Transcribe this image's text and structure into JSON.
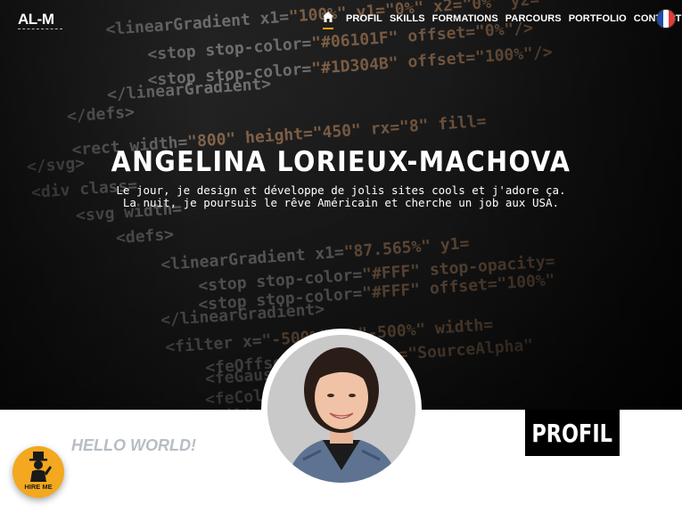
{
  "logo": {
    "text": "AL-M"
  },
  "nav": {
    "home_icon": "home-icon",
    "items": [
      {
        "label": "PROFIL"
      },
      {
        "label": "SKILLS"
      },
      {
        "label": "FORMATIONS"
      },
      {
        "label": "PARCOURS"
      },
      {
        "label": "PORTFOLIO"
      },
      {
        "label": "CONTACT"
      }
    ],
    "language_flag": "french-flag-icon",
    "accent_color": "#f0a500"
  },
  "hero": {
    "title": "ANGELINA LORIEUX-MACHOVA",
    "tagline_line1": "Le jour, je design et développe de jolis sites cools et j'adore ça.",
    "tagline_line2": "La nuit, je poursuis le rêve Américain et cherche un job aux USA.",
    "background_code": [
      {
        "code": "<linearGradient x1=",
        "str": "\"100%\" y1=\"0%\" x2=\"0%\" y2="
      },
      {
        "code": "<stop stop-color=",
        "str": "\"#06101F\" offset=\"0%\"/>"
      },
      {
        "code": "<stop stop-color=",
        "str": "\"#1D304B\" offset=\"100%\"/>"
      },
      {
        "code": "</linearGradient>",
        "str": ""
      },
      {
        "code": "</defs>",
        "str": ""
      },
      {
        "code": "<rect width=",
        "str": "\"800\" height=\"450\" rx=\"8\" fill="
      },
      {
        "code": "</svg>",
        "str": ""
      },
      {
        "code": "<div class=",
        "str": ""
      },
      {
        "code": "<svg width=",
        "str": ""
      },
      {
        "code": "<defs>",
        "str": ""
      },
      {
        "code": "<linearGradient x1=",
        "str": "\"87.565%\" y1="
      },
      {
        "code": "<stop stop-color=",
        "str": "\"#FFF\" stop-opacity="
      },
      {
        "code": "<stop stop-color=",
        "str": "\"#FFF\" offset=\"100%\""
      },
      {
        "code": "</linearGradient>",
        "str": ""
      },
      {
        "code": "<filter x=",
        "str": "\"-500%\" y=\"-500%\" width="
      },
      {
        "code": "<feOffset dy=",
        "str": "\"16\" in=\"SourceAlpha\""
      },
      {
        "code": "<feGaussi",
        "str": ""
      },
      {
        "code": "<feColo",
        "str": ""
      },
      {
        "code": "<filter",
        "str": ""
      }
    ]
  },
  "profile": {
    "hello": "HELLO WORLD!",
    "section_label": "PROFIL",
    "hire_label": "HIRE ME",
    "hire_color": "#f3a81f"
  }
}
